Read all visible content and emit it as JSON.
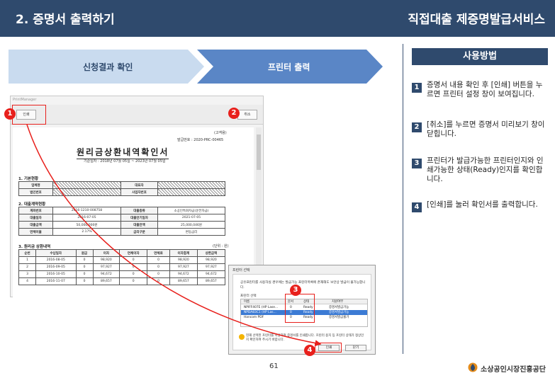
{
  "header": {
    "title_left": "2. 증명서 출력하기",
    "title_right": "직접대출 제증명발급서비스"
  },
  "steps": [
    {
      "label": "신청결과 확인"
    },
    {
      "label": "프린터 출력"
    }
  ],
  "howto": {
    "title": "사용방법",
    "items": [
      {
        "num": "1",
        "text": "증명서 내용 확인 후 [인쇄] 버튼을 누르면 프린터 설정 창이 보여집니다."
      },
      {
        "num": "2",
        "text": "[취소]를 누르면 증명서 미리보기 창이 닫힙니다."
      },
      {
        "num": "3",
        "text": "프린터가 발급가능한 프린터인지와 인쇄가능한 상태(Ready)인지를 확인합니다."
      },
      {
        "num": "4",
        "text": "[인쇄]를 눌러 확인서를 출력합니다."
      }
    ]
  },
  "viewer": {
    "window_title": "PrintManager",
    "print_button": "인쇄",
    "cancel_button": "취소",
    "doc": {
      "label_top": "(고객용)",
      "issue_no": "발급번호 : 2020-PRC-00465",
      "title": "원리금상환내역확인서",
      "period": "기준일자 : 2018년 07월 05일 ~ 2023년 07월 05일",
      "section1": "1. 기본현황",
      "basic_rows": [
        [
          "업체명",
          "",
          "대표자",
          ""
        ],
        [
          "법인번호",
          "",
          "사업자번호",
          ""
        ]
      ],
      "section2": "2. 대출계약현황",
      "contract_rows": [
        [
          "계좌번호",
          "2016-1210-008758",
          "대출종류",
          "소공인특화자금(운전자금)"
        ],
        [
          "대출일자",
          "2016-07-05",
          "대출만기일자",
          "2021-07-05"
        ],
        [
          "대출금액",
          "50,000,000원",
          "대출잔액",
          "25,000,046원"
        ],
        [
          "연체이율",
          "2.17%",
          "금리구분",
          "변동금리"
        ]
      ],
      "section3": "3. 원리금 상환내역",
      "unit": "(단위 : 원)",
      "repay_header": [
        "순번",
        "수납일자",
        "원금",
        "이자",
        "연체이자",
        "연체료",
        "이자합계",
        "상환금액"
      ],
      "repay_rows": [
        [
          "1",
          "2016-08-05",
          "0",
          "98,920",
          "0",
          "0",
          "98,920",
          "98,920"
        ],
        [
          "2",
          "2016-09-05",
          "0",
          "97,927",
          "0",
          "0",
          "97,927",
          "97,927"
        ],
        [
          "3",
          "2016-10-05",
          "0",
          "94,672",
          "0",
          "0",
          "94,672",
          "94,672"
        ],
        [
          "4",
          "2016-11-07",
          "0",
          "89,657",
          "0",
          "0",
          "89,657",
          "89,657"
        ]
      ]
    }
  },
  "dialog": {
    "title": "프린터 선택",
    "message": "공유프린터를 사용하실 경우에는 발급가능 프린터목록에 존재해도 보안상 발급이 불가능합니다.",
    "list_label": "프린터 선택",
    "columns": [
      "이름",
      "문서",
      "상태",
      "지원여부"
    ],
    "printers": [
      [
        "NPIFF407E (HP Lase...",
        "0",
        "Ready",
        "증명서발급가능"
      ],
      [
        "NPDA83C1 (HP Las...",
        "0",
        "Ready",
        "증명서발급가능"
      ],
      [
        "Hancom PDF",
        "0",
        "Ready",
        "증명서발급불가"
      ]
    ],
    "footer": "현재 선택된 프린터를 이용하여 증명서를 인쇄합니다. 프린터 용지 등 프린터 상태가 정상인지 확인하여 주시기 바랍니다.",
    "print_button": "인쇄",
    "close_button": "닫기"
  },
  "callouts": [
    "1",
    "2",
    "3",
    "4"
  ],
  "page_number": "61",
  "logo": {
    "name": "leaf-logo-icon",
    "text": "소상공인시장진흥공단"
  },
  "colors": {
    "header": "#2f4a6d",
    "step_active": "#5a86c6",
    "step_inactive": "#c9dbef",
    "highlight": "#e8201c"
  }
}
